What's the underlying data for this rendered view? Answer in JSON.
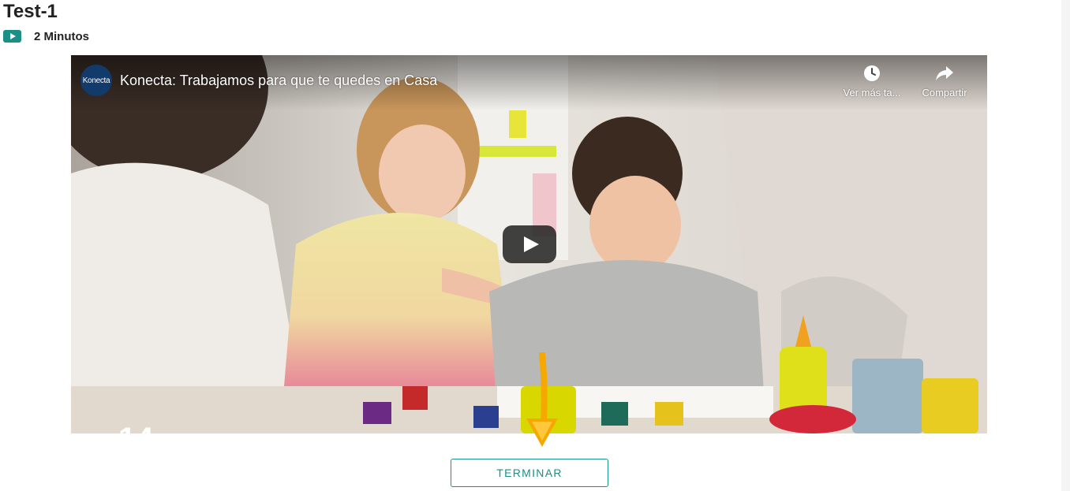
{
  "page": {
    "title": "Test-1"
  },
  "meta": {
    "duration": "2 Minutos",
    "badge_icon": "play-icon"
  },
  "video": {
    "channel_logo_text": "Konecta",
    "title": "Konecta: Trabajamos para que te quedes en Casa",
    "watch_later_label": "Ver más ta...",
    "share_label": "Compartir",
    "play_icon": "youtube-play-icon"
  },
  "actions": {
    "finish_label": "TERMINAR"
  },
  "colors": {
    "accent": "#1a8f85",
    "arrow": "#f5a800",
    "channel_logo": "#123a6b"
  }
}
